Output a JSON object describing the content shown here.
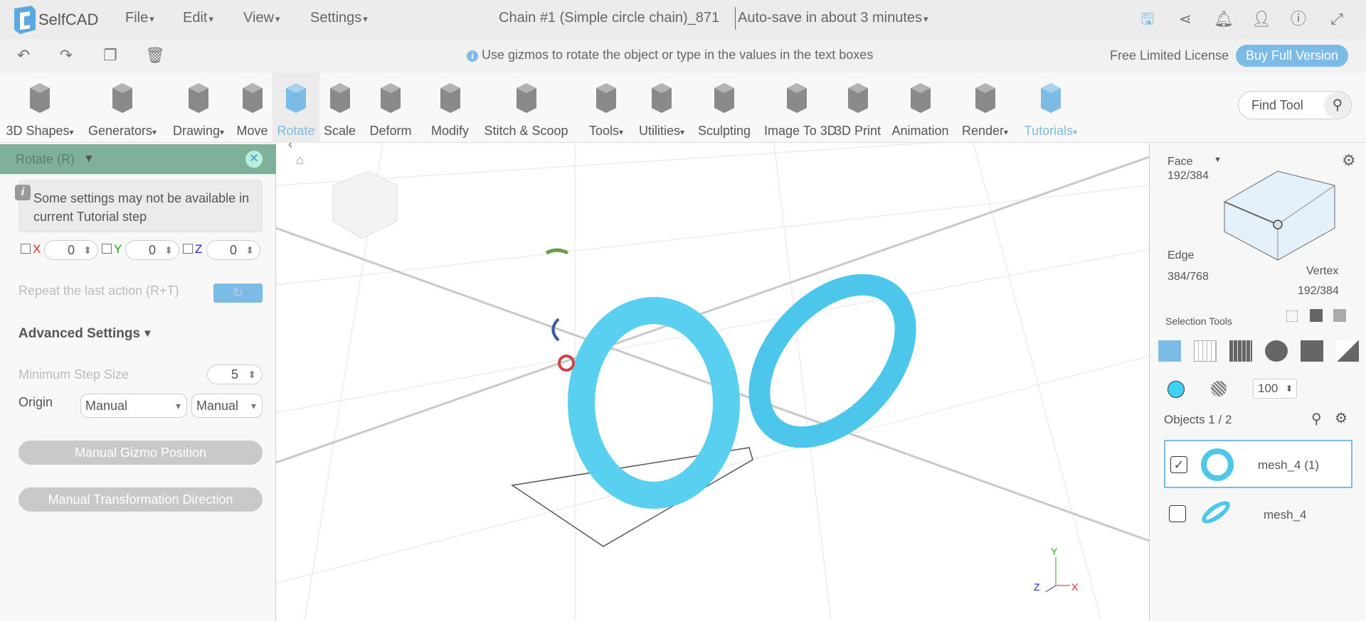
{
  "app": {
    "name": "SelfCAD",
    "menus": [
      "File",
      "Edit",
      "View",
      "Settings"
    ],
    "title": "Chain #1 (Simple circle chain)_871",
    "autosave": "Auto-save in about 3 minutes"
  },
  "header_icons": [
    "save-icon",
    "share-icon",
    "bell-icon",
    "user-icon",
    "info-icon",
    "fullscreen-icon"
  ],
  "row2": {
    "hint": "Use gizmos to rotate the object or type in the values in the text boxes",
    "license": "Free Limited License",
    "buy": "Buy Full Version"
  },
  "tools": [
    {
      "label": "3D Shapes"
    },
    {
      "label": "Generators"
    },
    {
      "label": "Drawing"
    },
    {
      "label": "Move"
    },
    {
      "label": "Rotate"
    },
    {
      "label": "Scale"
    },
    {
      "label": "Deform"
    },
    {
      "label": "Modify"
    },
    {
      "label": "Stitch & Scoop"
    },
    {
      "label": "Tools"
    },
    {
      "label": "Utilities"
    },
    {
      "label": "Sculpting"
    },
    {
      "label": "Image To 3D"
    },
    {
      "label": "3D Print"
    },
    {
      "label": "Animation"
    },
    {
      "label": "Render"
    },
    {
      "label": "Tutorials"
    }
  ],
  "find_tool": "Find Tool",
  "panel": {
    "title": "Rotate (R)",
    "notice": "Some settings may not be available in current Tutorial step",
    "x_label": "X",
    "y_label": "Y",
    "z_label": "Z",
    "x": "0",
    "y": "0",
    "z": "0",
    "repeat": "Repeat the last action (R+T)",
    "advanced": "Advanced Settings",
    "min_step_label": "Minimum Step Size",
    "min_step": "5",
    "origin_label": "Origin",
    "origin1": "Manual",
    "origin2": "Manual",
    "gizmo_btn": "Manual Gizmo Position",
    "direction_btn": "Manual Transformation Direction"
  },
  "right": {
    "face_label": "Face",
    "face_count": "192/384",
    "edge_label": "Edge",
    "edge_count": "384/768",
    "vertex_label": "Vertex",
    "vertex_count": "192/384",
    "selection_tools": "Selection Tools",
    "opacity": "100",
    "objects_label": "Objects 1 / 2",
    "objects": [
      {
        "name": "mesh_4 (1)",
        "checked": true
      },
      {
        "name": "mesh_4",
        "checked": false
      }
    ],
    "color": "#40d0f5"
  },
  "axes": {
    "x": "X",
    "y": "Y",
    "z": "Z"
  },
  "colors": {
    "accent": "#7bbbe6",
    "panel_header": "#7fb09a",
    "mesh": "#4cc6ea"
  }
}
